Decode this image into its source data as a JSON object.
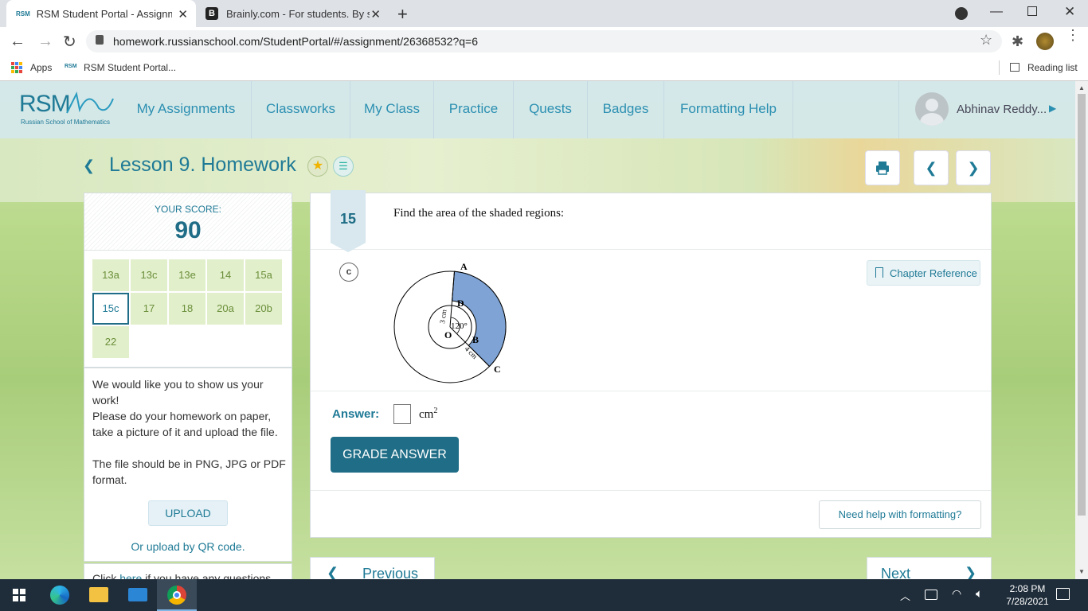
{
  "browser": {
    "tabs": [
      {
        "title": "RSM Student Portal - Assignment",
        "favicon": "RSM"
      },
      {
        "title": "Brainly.com - For students. By stu",
        "favicon": "B"
      }
    ],
    "url": "homework.russianschool.com/StudentPortal/#/assignment/26368532?q=6",
    "bookmarks": [
      {
        "label": "Apps",
        "icon": "apps-grid-icon"
      },
      {
        "label": "RSM Student Portal...",
        "icon": "RSM"
      }
    ],
    "reading_list": "Reading list"
  },
  "site": {
    "logo_text": "RSM",
    "logo_subtitle": "Russian School of Mathematics",
    "nav": [
      "My Assignments",
      "Classworks",
      "My Class",
      "Practice",
      "Quests",
      "Badges",
      "Formatting Help"
    ],
    "user_name": "Abhinav Reddy..."
  },
  "lesson": {
    "title": "Lesson 9. Homework"
  },
  "score": {
    "label": "YOUR SCORE:",
    "value": "90"
  },
  "problems": [
    "13a",
    "13c",
    "13e",
    "14",
    "15a",
    "15c",
    "17",
    "18",
    "20a",
    "20b",
    "22"
  ],
  "selected_problem": "15c",
  "upload": {
    "text1": "We would like you to show us your work!",
    "text2": "Please do your homework on paper, take a picture of it and upload the file.",
    "text3": "The file should be in PNG, JPG or PDF format.",
    "button": "UPLOAD",
    "qr_link": "Or upload by QR code.",
    "help_prefix": "Click ",
    "help_link": "here",
    "help_suffix": " if you have any questions."
  },
  "question": {
    "number": "15",
    "prompt": "Find the area of the shaded regions:",
    "part": "c",
    "chapter_ref": "Chapter Reference",
    "figure_labels": {
      "A": "A",
      "D": "D",
      "O": "O",
      "B": "B",
      "C": "C",
      "angle": "120°",
      "r_inner": "3 cm",
      "r_diff": "4 cm"
    },
    "answer_label": "Answer:",
    "answer_unit": "cm",
    "answer_unit_exp": "2",
    "grade_button": "GRADE ANSWER",
    "format_help": "Need help with formatting?",
    "prev": "Previous",
    "next": "Next"
  },
  "taskbar": {
    "time": "2:08 PM",
    "date": "7/28/2021"
  },
  "colors": {
    "accent": "#1f7a96",
    "shaded": "#7ea3d4",
    "cell_bg": "#e2efcb"
  }
}
